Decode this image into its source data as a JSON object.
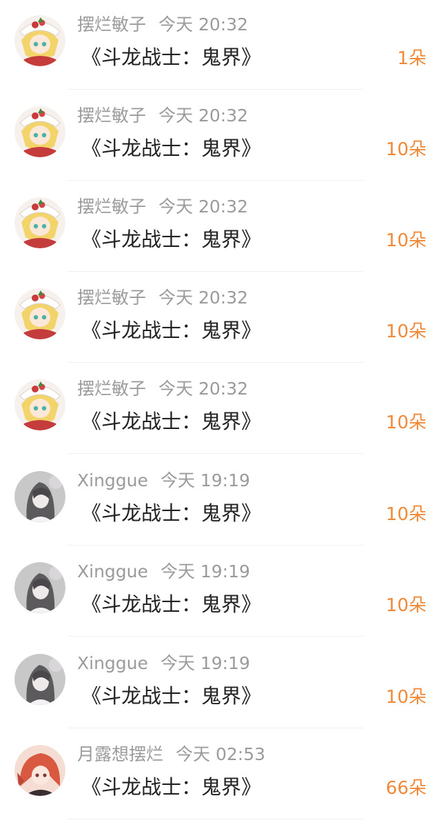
{
  "accent_color": "#f08a3a",
  "items": [
    {
      "name": "摆烂敏子",
      "time": "今天 20:32",
      "title": "《斗龙战士：鬼界》",
      "count": "1朵",
      "avatar": "anime-blonde-girl-avatar"
    },
    {
      "name": "摆烂敏子",
      "time": "今天 20:32",
      "title": "《斗龙战士：鬼界》",
      "count": "10朵",
      "avatar": "anime-blonde-girl-avatar"
    },
    {
      "name": "摆烂敏子",
      "time": "今天 20:32",
      "title": "《斗龙战士：鬼界》",
      "count": "10朵",
      "avatar": "anime-blonde-girl-avatar"
    },
    {
      "name": "摆烂敏子",
      "time": "今天 20:32",
      "title": "《斗龙战士：鬼界》",
      "count": "10朵",
      "avatar": "anime-blonde-girl-avatar"
    },
    {
      "name": "摆烂敏子",
      "time": "今天 20:32",
      "title": "《斗龙战士：鬼界》",
      "count": "10朵",
      "avatar": "anime-blonde-girl-avatar"
    },
    {
      "name": "Xinggue",
      "time": "今天 19:19",
      "title": "《斗龙战士：鬼界》",
      "count": "10朵",
      "avatar": "grey-sketch-girl-avatar"
    },
    {
      "name": "Xinggue",
      "time": "今天 19:19",
      "title": "《斗龙战士：鬼界》",
      "count": "10朵",
      "avatar": "grey-sketch-girl-avatar"
    },
    {
      "name": "Xinggue",
      "time": "今天 19:19",
      "title": "《斗龙战士：鬼界》",
      "count": "10朵",
      "avatar": "grey-sketch-girl-avatar"
    },
    {
      "name": "月露想摆烂",
      "time": "今天 02:53",
      "title": "《斗龙战士：鬼界》",
      "count": "66朵",
      "avatar": "red-hair-character-avatar"
    }
  ]
}
